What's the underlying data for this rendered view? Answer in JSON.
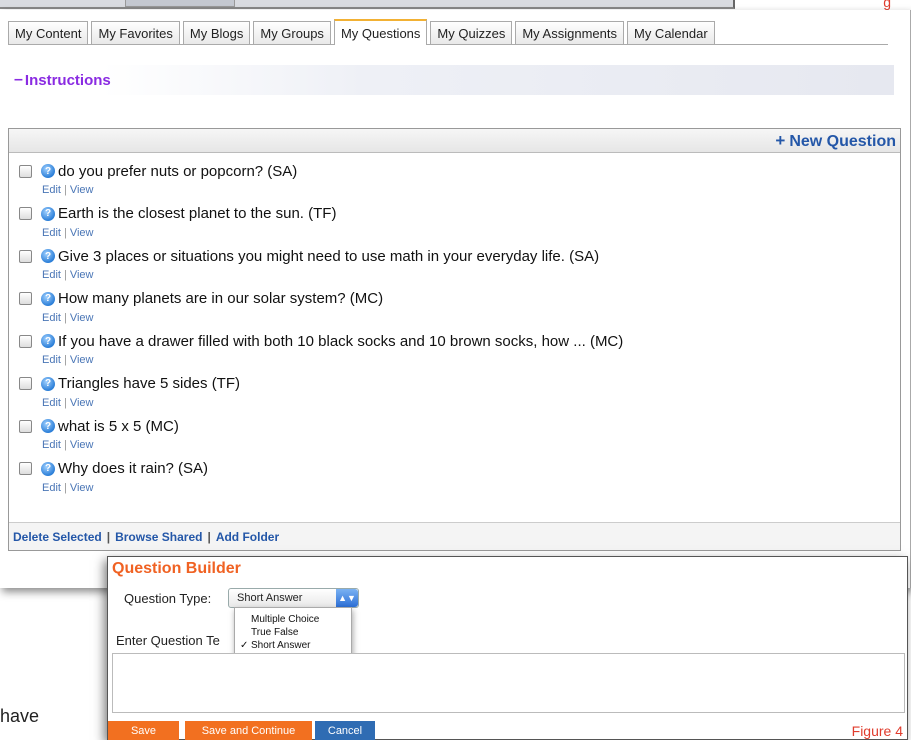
{
  "top_strip": {
    "figure_label": "g"
  },
  "tabs": [
    {
      "label": "My Content",
      "active": false
    },
    {
      "label": "My Favorites",
      "active": false
    },
    {
      "label": "My Blogs",
      "active": false
    },
    {
      "label": "My Groups",
      "active": false
    },
    {
      "label": "My Questions",
      "active": true
    },
    {
      "label": "My Quizzes",
      "active": false
    },
    {
      "label": "My Assignments",
      "active": false
    },
    {
      "label": "My Calendar",
      "active": false
    }
  ],
  "instructions": {
    "toggle": "–",
    "title": "Instructions"
  },
  "question_list": {
    "new_question_label": "New Question",
    "items": [
      {
        "text": "do you prefer nuts or popcorn? (SA)"
      },
      {
        "text": "Earth is the closest planet to the sun. (TF)"
      },
      {
        "text": "Give 3 places or situations you might need to use math in your everyday life. (SA)"
      },
      {
        "text": "How many planets are in our solar system? (MC)"
      },
      {
        "text": "If you have a drawer filled with both 10 black socks and 10 brown socks, how ... (MC)"
      },
      {
        "text": "Triangles have 5 sides (TF)"
      },
      {
        "text": "what is 5 x 5 (MC)"
      },
      {
        "text": "Why does it rain? (SA)"
      }
    ],
    "edit_label": "Edit",
    "view_label": "View",
    "footer": {
      "delete_selected": "Delete Selected",
      "browse_shared": "Browse Shared",
      "add_folder": "Add Folder"
    }
  },
  "bottom_left_text": "have",
  "builder": {
    "title": "Question Builder",
    "question_type_label": "Question Type:",
    "question_type_value": "Short Answer",
    "question_type_options": [
      "Multiple Choice",
      "True False",
      "Short Answer"
    ],
    "enter_question_label": "Enter Question Te",
    "save_label": "Save",
    "save_continue_label": "Save and Continue",
    "cancel_label": "Cancel",
    "figure_caption": "Figure 4"
  },
  "colors": {
    "tab_active_accent": "#f2b134",
    "instructions_purple": "#8a2be2",
    "link_blue": "#2457a8",
    "builder_orange": "#f06223",
    "button_orange": "#f27020",
    "button_blue": "#2f6cb3",
    "caption_red": "#e03c2d"
  }
}
